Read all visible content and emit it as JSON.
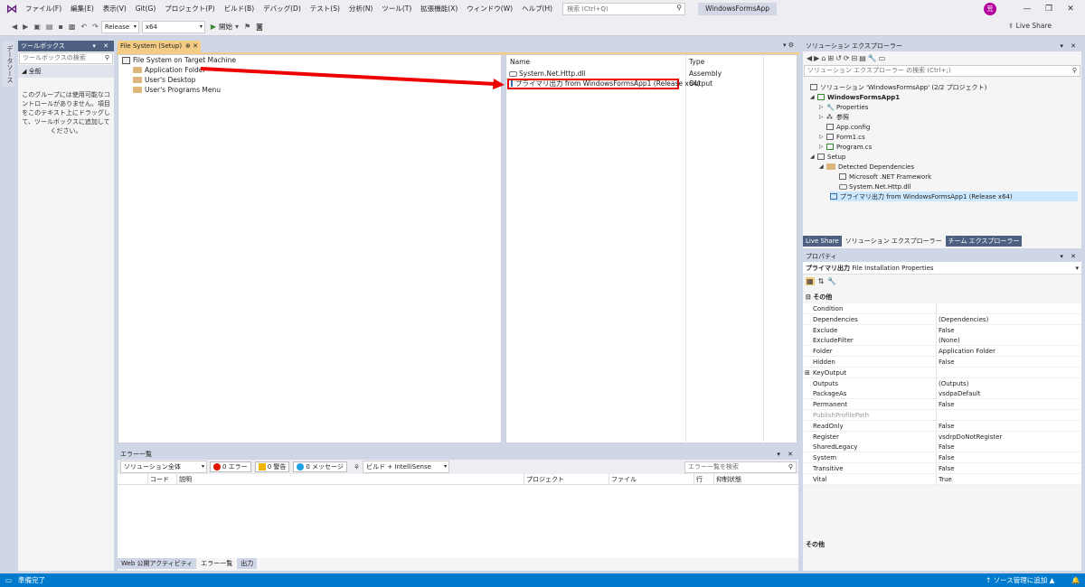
{
  "menu": {
    "items": [
      "ファイル(F)",
      "編集(E)",
      "表示(V)",
      "Git(G)",
      "プロジェクト(P)",
      "ビルド(B)",
      "デバッグ(D)",
      "テスト(S)",
      "分析(N)",
      "ツール(T)",
      "拡張機能(X)",
      "ウィンドウ(W)",
      "ヘルプ(H)"
    ],
    "search_placeholder": "検索 (Ctrl+Q)",
    "app_title": "WindowsFormsApp",
    "avatar_initial": "荒"
  },
  "toolbar": {
    "config": "Release",
    "platform": "x64",
    "start_label": "開始",
    "live_share": "Live Share"
  },
  "left_strip": {
    "tab": "データソース"
  },
  "toolbox": {
    "title": "ツールボックス",
    "search_placeholder": "ツールボックスの検索",
    "group": "◢ 全般",
    "empty_message": "このグループには使用可能なコントロールがありません。項目をこのテキスト上にドラッグして、ツールボックスに追加してください。"
  },
  "editor": {
    "tab": "File System (Setup)",
    "tree": {
      "root": "File System on Target Machine",
      "children": [
        "Application Folder",
        "User's Desktop",
        "User's Programs Menu"
      ]
    },
    "list": {
      "col_name": "Name",
      "col_type": "Type",
      "rows": [
        {
          "name": "System.Net.Http.dll",
          "type": "Assembly"
        },
        {
          "name": "プライマリ出力 from WindowsFormsApp1 (Release x64)",
          "type": "Output"
        }
      ]
    }
  },
  "error_list": {
    "title": "エラー一覧",
    "scope": "ソリューション全体",
    "errors": "0 エラー",
    "warnings": "0 警告",
    "messages": "0 メッセージ",
    "build_filter": "ビルド + IntelliSense",
    "search_placeholder": "エラー一覧を検索",
    "headers": [
      "コード",
      "説明",
      "プロジェクト",
      "ファイル",
      "行",
      "抑制状態"
    ],
    "tabs": [
      "Web 公開アクティビティ",
      "エラー一覧",
      "出力"
    ]
  },
  "solution_explorer": {
    "title": "ソリューション エクスプローラー",
    "search_placeholder": "ソリューション エクスプローラー の検索 (Ctrl+;)",
    "items": [
      "ソリューション 'WindowsFormsApp' (2/2 プロジェクト)",
      "WindowsFormsApp1",
      "Properties",
      "参照",
      "App.config",
      "Form1.cs",
      "Program.cs",
      "Setup",
      "Detected Dependencies",
      "Microsoft .NET Framework",
      "System.Net.Http.dll",
      "プライマリ出力 from WindowsFormsApp1 (Release x64)"
    ],
    "tabs": [
      "Live Share",
      "ソリューション エクスプローラー",
      "チーム エクスプローラー"
    ]
  },
  "properties": {
    "title": "プロパティ",
    "object_name": "プライマリ出力",
    "object_type": "File Installation Properties",
    "category": "⊟ その他",
    "rows": [
      {
        "name": "Condition",
        "value": ""
      },
      {
        "name": "Dependencies",
        "value": "(Dependencies)"
      },
      {
        "name": "Exclude",
        "value": "False"
      },
      {
        "name": "ExcludeFilter",
        "value": "(None)"
      },
      {
        "name": "Folder",
        "value": "Application Folder"
      },
      {
        "name": "Hidden",
        "value": "False"
      },
      {
        "name": "KeyOutput",
        "value": ""
      },
      {
        "name": "Outputs",
        "value": "(Outputs)"
      },
      {
        "name": "PackageAs",
        "value": "vsdpaDefault"
      },
      {
        "name": "Permanent",
        "value": "False"
      },
      {
        "name": "PublishProfilePath",
        "value": ""
      },
      {
        "name": "ReadOnly",
        "value": "False"
      },
      {
        "name": "Register",
        "value": "vsdrpDoNotRegister"
      },
      {
        "name": "SharedLegacy",
        "value": "False"
      },
      {
        "name": "System",
        "value": "False"
      },
      {
        "name": "Transitive",
        "value": "False"
      },
      {
        "name": "Vital",
        "value": "True"
      }
    ],
    "description_title": "その他"
  },
  "status": {
    "left": "準備完了",
    "right": "↑ ソース管理に追加 ▲"
  }
}
